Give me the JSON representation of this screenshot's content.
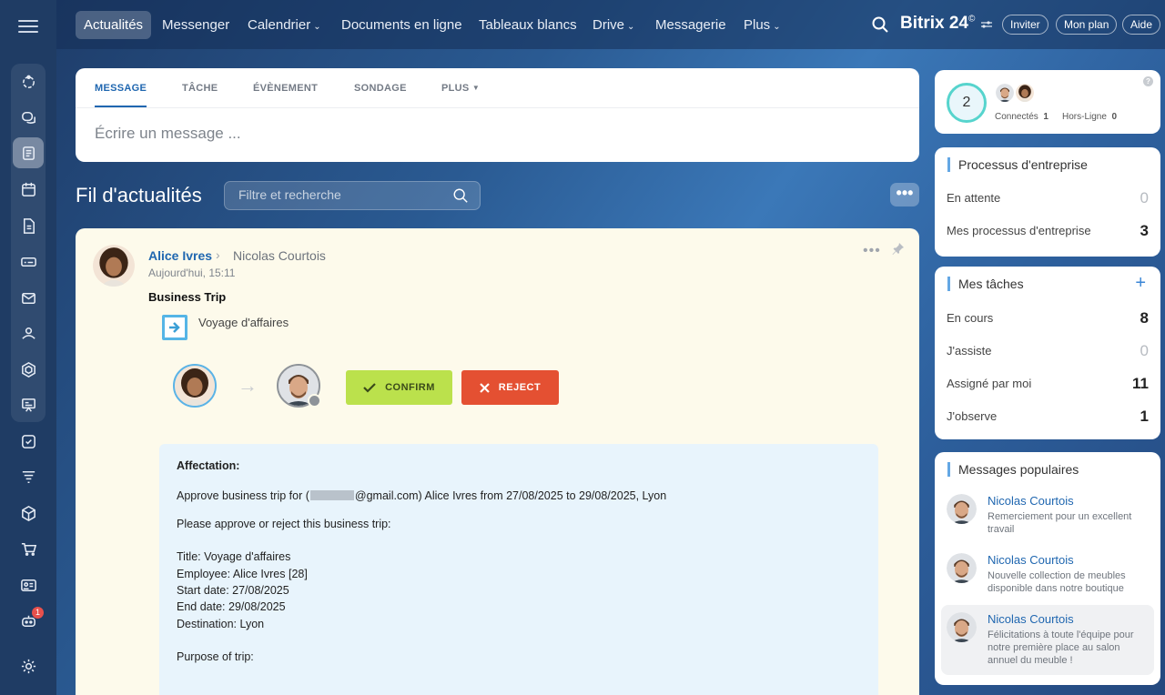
{
  "nav": {
    "items": [
      {
        "label": "Actualités"
      },
      {
        "label": "Messenger"
      },
      {
        "label": "Calendrier",
        "chevron": "⌄"
      },
      {
        "label": "Documents en ligne"
      },
      {
        "label": "Tableaux blancs"
      },
      {
        "label": "Drive",
        "chevron": "⌄"
      },
      {
        "label": "Messagerie"
      },
      {
        "label": "Plus",
        "chevron": "⌄"
      }
    ],
    "brand": "Bitrix 24",
    "brand_mark": "©",
    "invite": "Inviter",
    "plan": "Mon plan",
    "help": "Aide"
  },
  "sidebar": {
    "badge": "1",
    "icons": [
      "activity-icon",
      "chat-icon",
      "feed-icon",
      "calendar-icon",
      "document-icon",
      "drive-icon",
      "mail-icon",
      "contacts-icon",
      "hexagon-icon",
      "presentation-icon",
      "tasks-icon",
      "filter-icon",
      "box-icon",
      "cart-icon",
      "id-card-icon",
      "bot-icon",
      "settings-icon"
    ]
  },
  "composer": {
    "tabs": [
      "MESSAGE",
      "TÂCHE",
      "ÉVÈNEMENT",
      "SONDAGE",
      "PLUS"
    ],
    "placeholder": "Écrire un message ..."
  },
  "feed": {
    "title": "Fil d'actualités",
    "filter_placeholder": "Filtre et recherche",
    "more": "•••"
  },
  "post": {
    "author": "Alice Ivres",
    "arrow": "›",
    "recipient": "Nicolas Courtois",
    "time": "Aujourd'hui, 15:11",
    "title": "Business Trip",
    "process_label": "Voyage d'affaires",
    "dots": "•••",
    "confirm": "CONFIRM",
    "reject": "REJECT",
    "details": {
      "heading": "Affectation:",
      "approve_pre": "Approve business trip for (",
      "approve_post": "@gmail.com) Alice Ivres from 27/08/2025 to 29/08/2025, Lyon",
      "please": "Please approve or reject this business trip:",
      "title_line": "Title: Voyage d'affaires",
      "employee_line": "Employee: Alice Ivres [28]",
      "start_line": "Start date: 27/08/2025",
      "end_line": "End date: 29/08/2025",
      "dest_line": "Destination: Lyon",
      "purpose_line": "Purpose of trip:"
    }
  },
  "online": {
    "count": "2",
    "connected_label": "Connectés",
    "connected_count": "1",
    "offline_label": "Hors-Ligne",
    "offline_count": "0",
    "help": "?"
  },
  "processes": {
    "title": "Processus d'entreprise",
    "rows": [
      {
        "label": "En attente",
        "value": "0"
      },
      {
        "label": "Mes processus d'entreprise",
        "value": "3"
      }
    ]
  },
  "tasks": {
    "title": "Mes tâches",
    "add": "+",
    "rows": [
      {
        "label": "En cours",
        "value": "8"
      },
      {
        "label": "J'assiste",
        "value": "0"
      },
      {
        "label": "Assigné par moi",
        "value": "11"
      },
      {
        "label": "J'observe",
        "value": "1"
      }
    ]
  },
  "popular": {
    "title": "Messages populaires",
    "items": [
      {
        "name": "Nicolas Courtois",
        "text": "Remerciement pour un excellent travail"
      },
      {
        "name": "Nicolas Courtois",
        "text": "Nouvelle collection de meubles disponible dans notre boutique"
      },
      {
        "name": "Nicolas Courtois",
        "text": "Félicitations à toute l'équipe pour notre première place au salon annuel du meuble !"
      }
    ]
  },
  "colors": {
    "accent": "#2067b0",
    "confirm": "#bbe14c",
    "reject": "#e45032",
    "post_bg": "#fdfaeb",
    "details_bg": "#e8f4fc"
  }
}
